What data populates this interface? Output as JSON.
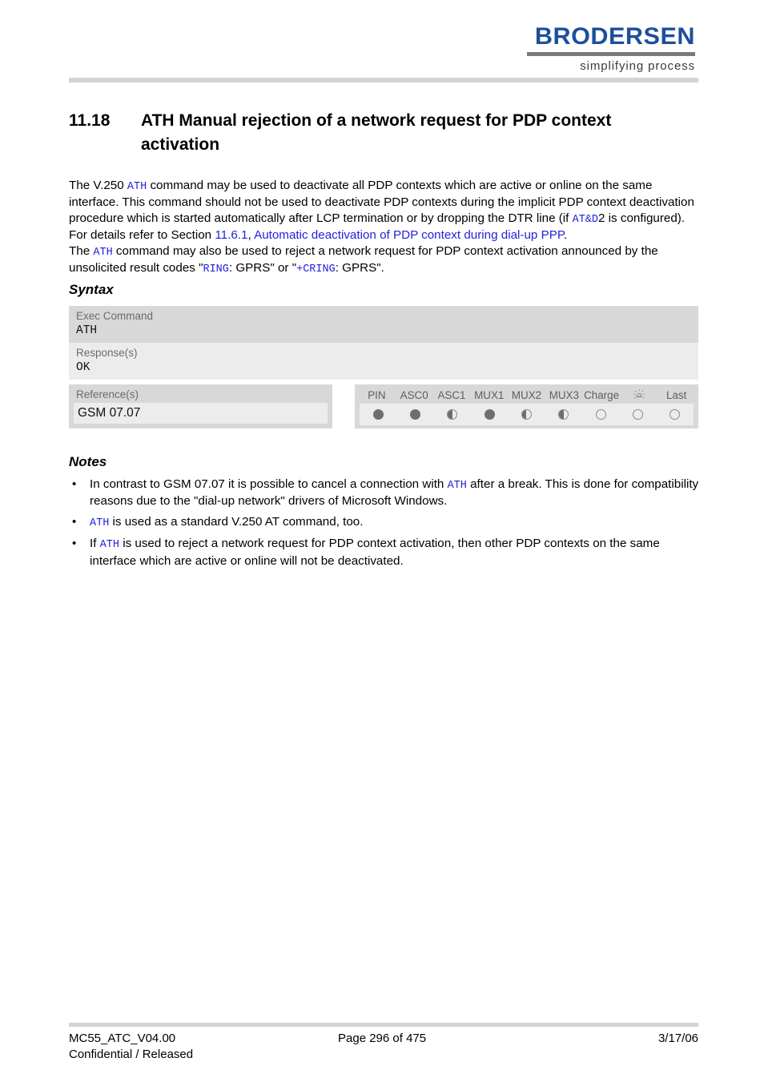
{
  "header": {
    "logo_word": "BRODERSEN",
    "logo_tagline": "simplifying process",
    "logo_color": "#1c4f9c"
  },
  "title": {
    "number": "11.18",
    "text": "ATH   Manual rejection of a network request for PDP context activation"
  },
  "body": {
    "p1_a": "The V.250 ",
    "p1_code1": "ATH",
    "p1_b": " command may be used to deactivate all PDP contexts which are active or online on the same interface. This command should not be used to deactivate PDP contexts during the implicit PDP context deactivation procedure which is started automatically after LCP termination or by dropping the DTR line (if ",
    "p1_code2": "AT&D",
    "p1_c": "2 is configured). For details refer to Section ",
    "p1_link1": "11.6.1",
    "p1_d": ", ",
    "p1_link2": "Automatic deactivation of PDP context during dial-up PPP",
    "p1_e": ".",
    "p2_a": "The ",
    "p2_code1": "ATH",
    "p2_b": " command may also be used to reject a network request for PDP context activation announced by the unsolicited result codes \"",
    "p2_code2": "RING",
    "p2_c": ": GPRS\" or \"",
    "p2_code3": "+CRING",
    "p2_d": ": GPRS\"."
  },
  "syntax": {
    "heading": "Syntax",
    "exec_label": "Exec Command",
    "exec_value": "ATH",
    "response_label": "Response(s)",
    "response_value": "OK"
  },
  "reference": {
    "label": "Reference(s)",
    "value": "GSM 07.07"
  },
  "status": {
    "columns": [
      {
        "label": "PIN",
        "state": "full"
      },
      {
        "label": "ASC0",
        "state": "full"
      },
      {
        "label": "ASC1",
        "state": "half"
      },
      {
        "label": "MUX1",
        "state": "full"
      },
      {
        "label": "MUX2",
        "state": "half"
      },
      {
        "label": "MUX3",
        "state": "half"
      },
      {
        "label": "Charge",
        "state": "empty"
      },
      {
        "label": "",
        "state": "empty",
        "icon": "wake-up-icon"
      },
      {
        "label": "Last",
        "state": "empty"
      }
    ]
  },
  "notes": {
    "heading": "Notes",
    "bullet": "•",
    "items": [
      {
        "a": "In contrast to GSM 07.07 it is possible to cancel a connection with ",
        "code": "ATH",
        "b": " after a break. This is done for compatibility reasons due to the \"dial-up network\" drivers of Microsoft Windows."
      },
      {
        "a": "",
        "code": "ATH",
        "b": " is used as a standard V.250 AT command, too."
      },
      {
        "a": "If ",
        "code": "ATH",
        "b": " is used to reject a network request for PDP context activation, then other PDP contexts on the same interface which are active or online will not be deactivated."
      }
    ]
  },
  "footer": {
    "doc_id": "MC55_ATC_V04.00",
    "classification": "Confidential / Released",
    "page": "Page 296 of 475",
    "date": "3/17/06"
  }
}
